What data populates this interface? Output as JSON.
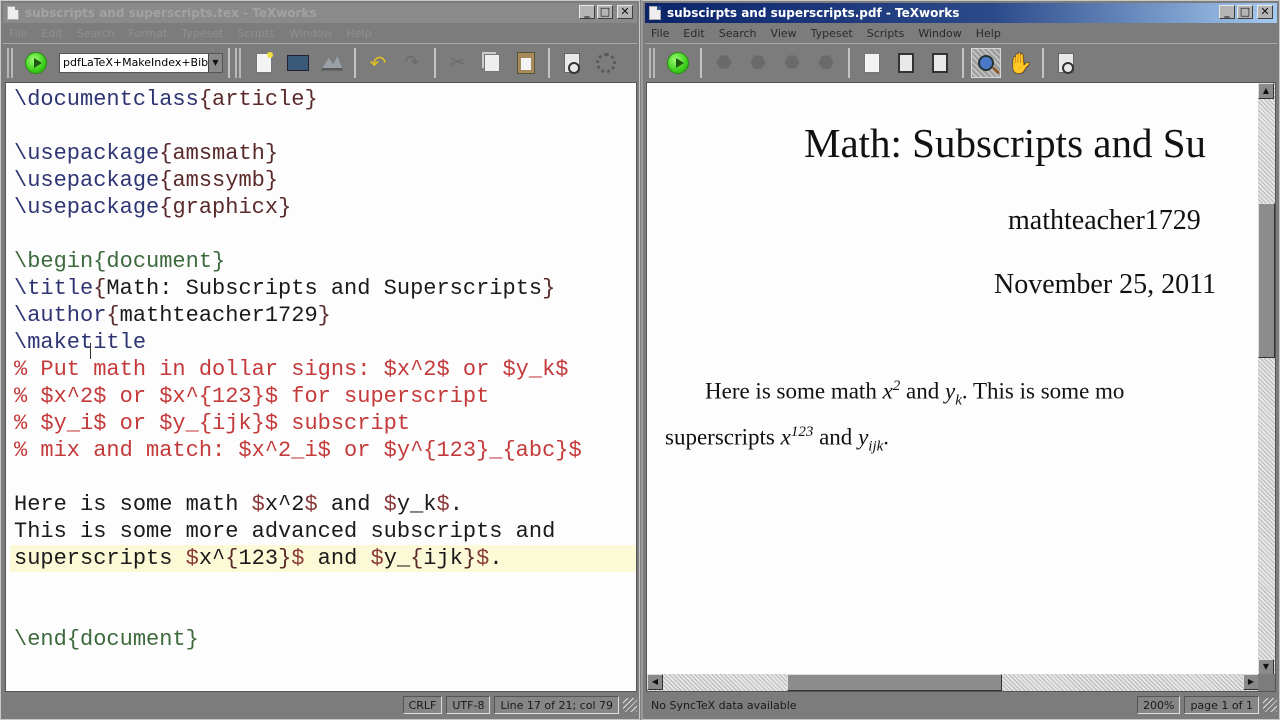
{
  "source_window": {
    "title": "subscripts and superscripts.tex - TeXworks",
    "menu": [
      "File",
      "Edit",
      "Search",
      "Format",
      "Typeset",
      "Scripts",
      "Window",
      "Help"
    ],
    "toolbar": {
      "typeset_engine": "pdfLaTeX+MakeIndex+BibTeX",
      "icons": [
        "typeset-icon",
        "new-document-icon",
        "open-document-icon",
        "save-icon",
        "undo-icon",
        "redo-icon",
        "cut-icon",
        "copy-icon",
        "paste-icon",
        "find-icon",
        "replace-icon"
      ]
    },
    "editor": {
      "current_line": 18,
      "lines": [
        [
          {
            "t": "\\documentclass",
            "c": "cmd"
          },
          {
            "t": "{",
            "c": "brace"
          },
          {
            "t": "article",
            "c": "arg"
          },
          {
            "t": "}",
            "c": "brace"
          }
        ],
        [],
        [
          {
            "t": "\\usepackage",
            "c": "cmd"
          },
          {
            "t": "{",
            "c": "brace"
          },
          {
            "t": "amsmath",
            "c": "arg"
          },
          {
            "t": "}",
            "c": "brace"
          }
        ],
        [
          {
            "t": "\\usepackage",
            "c": "cmd"
          },
          {
            "t": "{",
            "c": "brace"
          },
          {
            "t": "amssymb",
            "c": "arg"
          },
          {
            "t": "}",
            "c": "brace"
          }
        ],
        [
          {
            "t": "\\usepackage",
            "c": "cmd"
          },
          {
            "t": "{",
            "c": "brace"
          },
          {
            "t": "graphicx",
            "c": "arg"
          },
          {
            "t": "}",
            "c": "brace"
          }
        ],
        [],
        [
          {
            "t": "\\begin",
            "c": "env"
          },
          {
            "t": "{document}",
            "c": "env"
          }
        ],
        [
          {
            "t": "\\title",
            "c": "cmd"
          },
          {
            "t": "{",
            "c": "brace"
          },
          {
            "t": "Math: Subscripts and Superscripts",
            "c": "mtext"
          },
          {
            "t": "}",
            "c": "brace"
          }
        ],
        [
          {
            "t": "\\author",
            "c": "cmd"
          },
          {
            "t": "{",
            "c": "brace"
          },
          {
            "t": "mathteacher1729",
            "c": "mtext"
          },
          {
            "t": "}",
            "c": "brace"
          }
        ],
        [
          {
            "t": "\\maketitle",
            "c": "cmd"
          }
        ],
        [
          {
            "t": "% Put math in dollar signs: $x^2$ or $y_k$",
            "c": "cmt"
          }
        ],
        [
          {
            "t": "% $x^2$ or $x^{123}$ for superscript",
            "c": "cmt"
          }
        ],
        [
          {
            "t": "% $y_i$ or $y_{ijk}$ subscript",
            "c": "cmt"
          }
        ],
        [
          {
            "t": "% mix and match: $x^2_i$ or $y^{123}_{abc}$",
            "c": "cmt"
          }
        ],
        [],
        [
          {
            "t": "Here is some math ",
            "c": "mtext"
          },
          {
            "t": "$",
            "c": "math"
          },
          {
            "t": "x^2",
            "c": "mtext"
          },
          {
            "t": "$",
            "c": "math"
          },
          {
            "t": " and ",
            "c": "mtext"
          },
          {
            "t": "$",
            "c": "math"
          },
          {
            "t": "y_k",
            "c": "mtext"
          },
          {
            "t": "$",
            "c": "math"
          },
          {
            "t": ".",
            "c": "mtext"
          }
        ],
        [
          {
            "t": "This is some more advanced subscripts and",
            "c": "mtext"
          }
        ],
        [
          {
            "t": "superscripts ",
            "c": "mtext"
          },
          {
            "t": "$",
            "c": "math"
          },
          {
            "t": "x^",
            "c": "mtext"
          },
          {
            "t": "{",
            "c": "brace"
          },
          {
            "t": "123",
            "c": "mtext"
          },
          {
            "t": "}",
            "c": "brace"
          },
          {
            "t": "$",
            "c": "math"
          },
          {
            "t": " and ",
            "c": "mtext"
          },
          {
            "t": "$",
            "c": "math"
          },
          {
            "t": "y_",
            "c": "mtext"
          },
          {
            "t": "{",
            "c": "brace"
          },
          {
            "t": "ijk",
            "c": "mtext"
          },
          {
            "t": "}",
            "c": "brace"
          },
          {
            "t": "$",
            "c": "math"
          },
          {
            "t": ".",
            "c": "mtext"
          }
        ],
        [],
        [],
        [
          {
            "t": "\\end",
            "c": "env"
          },
          {
            "t": "{document}",
            "c": "env"
          }
        ]
      ]
    },
    "status": {
      "line_ending": "CRLF",
      "encoding": "UTF-8",
      "position": "Line 17 of 21; col 79"
    }
  },
  "pdf_window": {
    "title": "subscirpts and superscripts.pdf - TeXworks",
    "menu": [
      "File",
      "Edit",
      "Search",
      "View",
      "Typeset",
      "Scripts",
      "Window",
      "Help"
    ],
    "toolbar": {
      "icons": [
        "typeset-icon",
        "first-page-icon",
        "previous-page-icon",
        "next-page-icon",
        "last-page-icon",
        "actual-size-icon",
        "fit-width-icon",
        "fit-window-icon",
        "magnify-icon",
        "hand-tool-icon",
        "go-to-source-icon"
      ],
      "active_tool": "magnify-icon"
    },
    "document": {
      "title": "Math: Subscripts and Su",
      "author": "mathteacher1729",
      "date": "November 25, 2011",
      "para_line1_a": "Here is some math ",
      "para_line1_x": "x",
      "para_line1_sup": "2",
      "para_line1_b": " and ",
      "para_line1_y": "y",
      "para_line1_sub": "k",
      "para_line1_c": ". This is some mo",
      "para_line2_a": "superscripts ",
      "para_line2_x": "x",
      "para_line2_sup": "123",
      "para_line2_b": " and ",
      "para_line2_y": "y",
      "para_line2_sub": "ijk",
      "para_line2_c": "."
    },
    "status": {
      "message": "No SyncTeX data available",
      "zoom": "200%",
      "page": "page 1 of 1"
    }
  },
  "window_buttons": {
    "minimize": "_",
    "maximize": "□",
    "close": "✕"
  },
  "scroll_arrows": {
    "up": "▲",
    "down": "▼",
    "left": "◀",
    "right": "▶"
  }
}
